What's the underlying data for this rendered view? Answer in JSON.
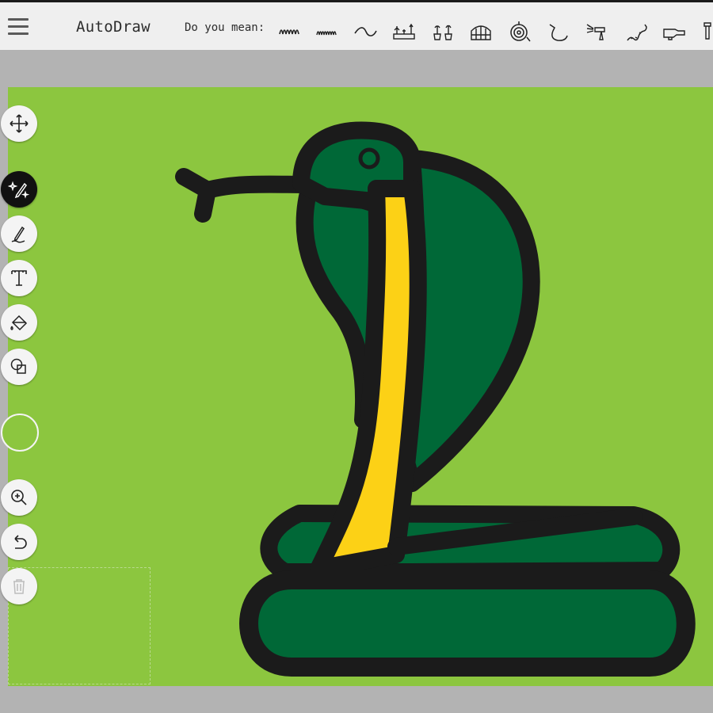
{
  "app": {
    "title": "AutoDraw"
  },
  "suggestions": {
    "prompt": "Do you mean:",
    "items": [
      {
        "name": "squiggle-1"
      },
      {
        "name": "squiggle-2"
      },
      {
        "name": "wave"
      },
      {
        "name": "garden-bed"
      },
      {
        "name": "potted-plants"
      },
      {
        "name": "greenhouse"
      },
      {
        "name": "garden-hose-reel"
      },
      {
        "name": "garden-hose"
      },
      {
        "name": "spray-nozzle"
      },
      {
        "name": "snake"
      },
      {
        "name": "hand-sprayer"
      },
      {
        "name": "hose-nozzle"
      }
    ]
  },
  "toolbar": {
    "tools": [
      {
        "name": "move",
        "icon": "move-icon"
      },
      {
        "name": "autodraw",
        "icon": "autodraw-sparkle-icon",
        "active": true
      },
      {
        "name": "draw",
        "icon": "pencil-icon"
      },
      {
        "name": "type",
        "icon": "text-icon"
      },
      {
        "name": "fill",
        "icon": "paint-bucket-icon"
      },
      {
        "name": "shape",
        "icon": "shapes-icon"
      },
      {
        "name": "zoom",
        "icon": "zoom-in-icon"
      },
      {
        "name": "undo",
        "icon": "undo-icon"
      },
      {
        "name": "delete",
        "icon": "trash-icon",
        "disabled": true
      }
    ],
    "current_color": "#8cc63f"
  },
  "colors": {
    "canvas_bg": "#8cc63f",
    "snake_body": "#006837",
    "snake_belly": "#fcd116",
    "outline": "#1b1b1b"
  }
}
